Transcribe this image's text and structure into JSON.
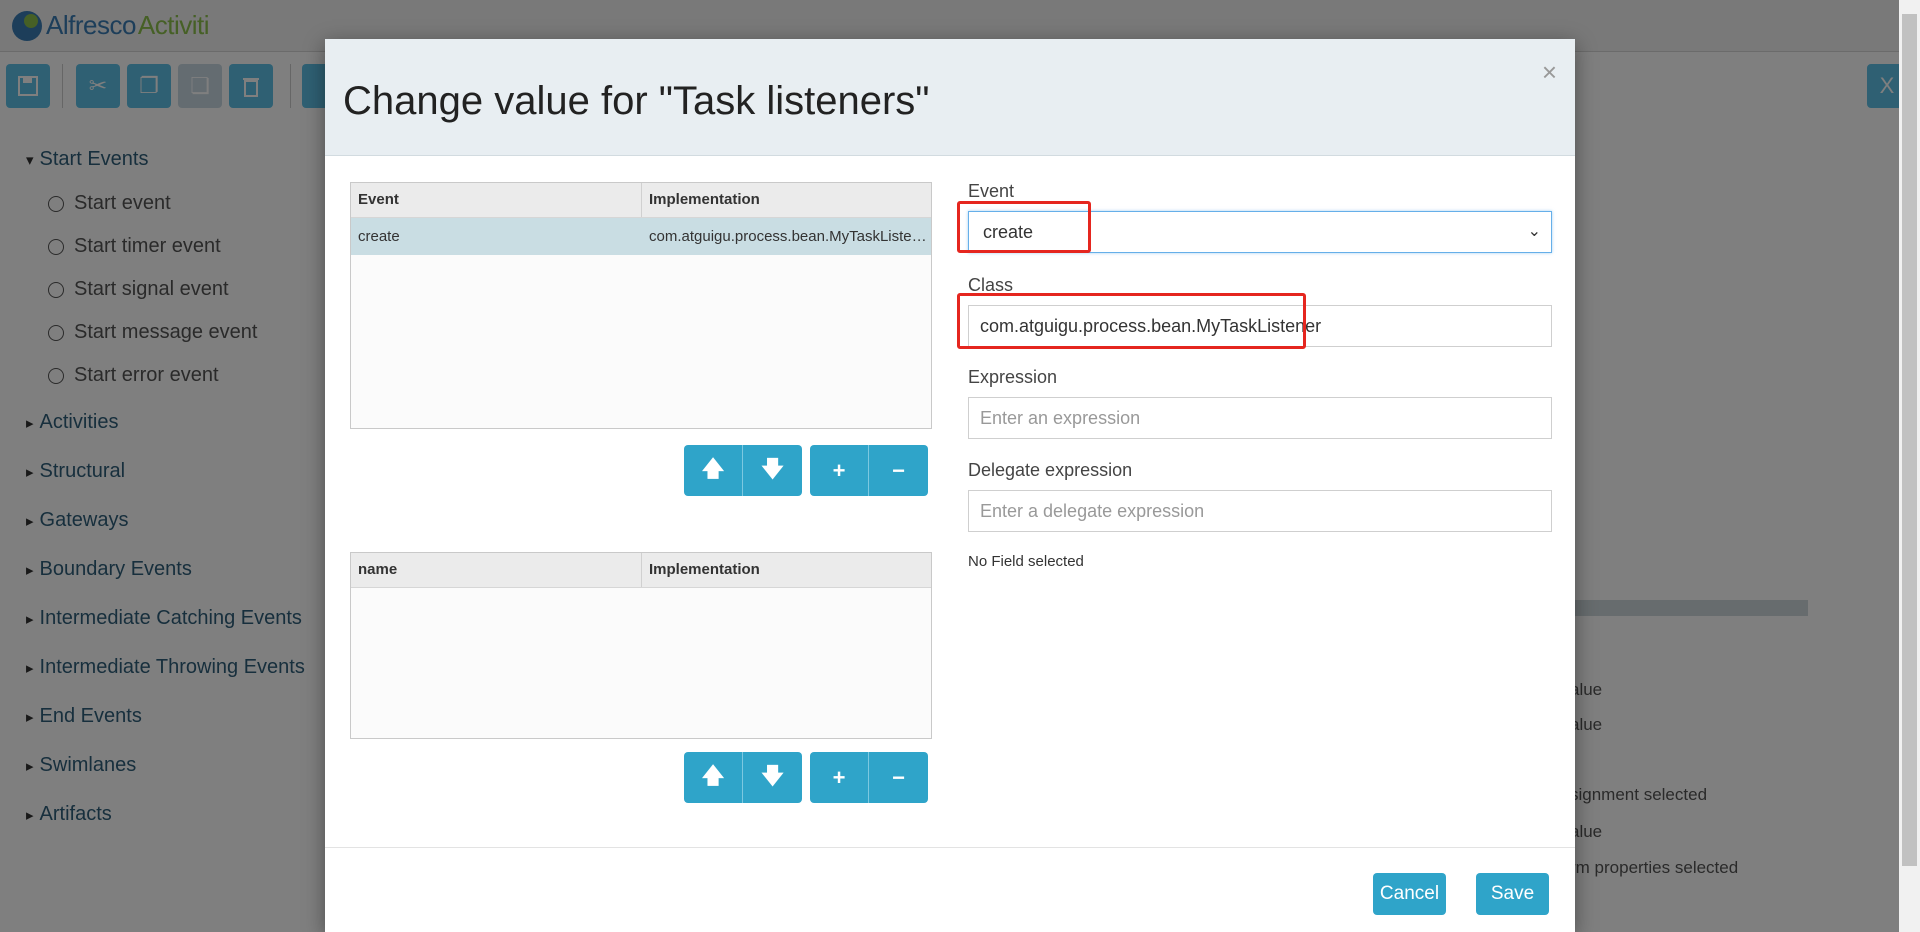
{
  "app": {
    "logo_a": "Alfresco",
    "logo_b": "Activiti"
  },
  "palette": {
    "start_events": "Start Events",
    "items": [
      "Start event",
      "Start timer event",
      "Start signal event",
      "Start message event",
      "Start error event"
    ],
    "groups": [
      "Activities",
      "Structural",
      "Gateways",
      "Boundary Events",
      "Intermediate Catching Events",
      "Intermediate Throwing Events",
      "End Events",
      "Swimlanes",
      "Artifacts"
    ]
  },
  "background_props": [
    "alue",
    "alue",
    "signment selected",
    "alue",
    "rm properties selected"
  ],
  "modal": {
    "title": "Change value for \"Task listeners\"",
    "close": "×",
    "listeners_grid": {
      "headers": [
        "Event",
        "Implementation"
      ],
      "rows": [
        {
          "event": "create",
          "implementation": "com.atguigu.process.bean.MyTaskListener"
        }
      ]
    },
    "fields_grid": {
      "headers": [
        "name",
        "Implementation"
      ]
    },
    "event": {
      "label": "Event",
      "value": "create"
    },
    "class": {
      "label": "Class",
      "value": "com.atguigu.process.bean.MyTaskListener"
    },
    "expression": {
      "label": "Expression",
      "placeholder": "Enter an expression"
    },
    "delegate_expression": {
      "label": "Delegate expression",
      "placeholder": "Enter a delegate expression"
    },
    "no_field": "No Field selected",
    "cancel": "Cancel",
    "save": "Save"
  },
  "colors": {
    "accent": "#2fa4c9",
    "highlight": "#e5261f",
    "selected_row": "#c9dde3"
  }
}
